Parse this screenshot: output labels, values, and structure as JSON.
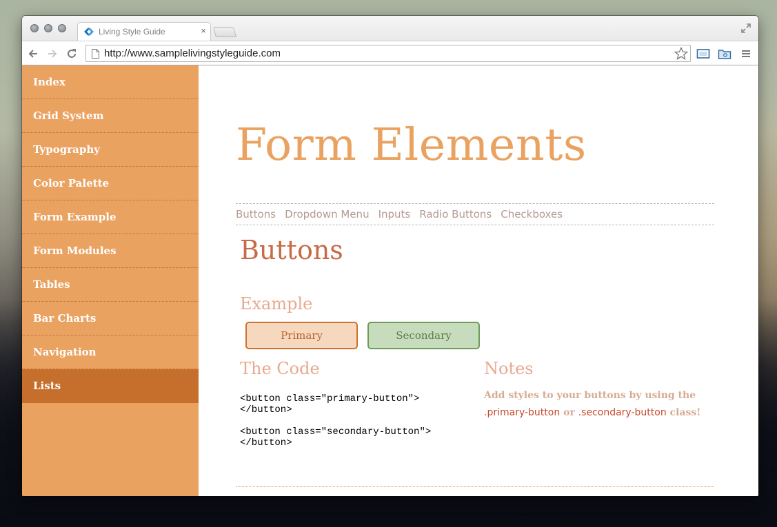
{
  "browser": {
    "tab_title": "Living Style Guide",
    "tab_close": "×",
    "url": "http://www.samplelivingstyleguide.com"
  },
  "sidebar": {
    "items": [
      {
        "label": "Index"
      },
      {
        "label": "Grid System"
      },
      {
        "label": "Typography"
      },
      {
        "label": "Color Palette"
      },
      {
        "label": "Form Example"
      },
      {
        "label": "Form Modules"
      },
      {
        "label": "Tables"
      },
      {
        "label": "Bar Charts"
      },
      {
        "label": "Navigation"
      },
      {
        "label": "Lists",
        "active": true
      }
    ]
  },
  "main": {
    "title": "Form Elements",
    "subnav": [
      "Buttons",
      "Dropdown Menu",
      "Inputs",
      "Radio Buttons",
      "Checkboxes"
    ],
    "section_title": "Buttons",
    "example_heading": "Example",
    "primary_label": "Primary",
    "secondary_label": "Secondary",
    "code_heading": "The Code",
    "code_lines": "<button class=\"primary-button\">\n</button>\n\n<button class=\"secondary-button\">\n</button>",
    "notes_heading": "Notes",
    "notes_text_1": "Add styles to your buttons by using the",
    "notes_class_1": ".primary-button",
    "notes_or": "or",
    "notes_class_2": ".secondary-button",
    "notes_class_suffix": "class!"
  },
  "colors": {
    "sidebar_bg": "#eaa261",
    "sidebar_active": "#c66f2c",
    "title": "#eaa261",
    "section_title": "#c86a45",
    "primary_button_bg": "#f6d8bf",
    "secondary_button_bg": "#c7dcbc",
    "class_name": "#c8492d"
  }
}
